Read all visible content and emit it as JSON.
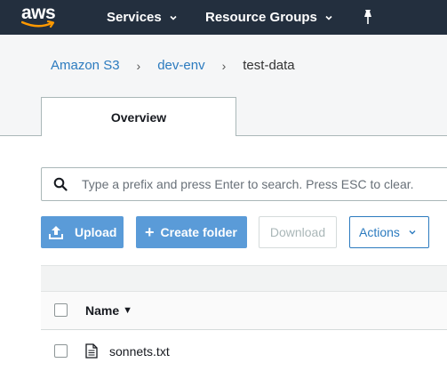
{
  "header": {
    "logo_text": "aws",
    "nav": {
      "services_label": "Services",
      "resource_groups_label": "Resource Groups"
    }
  },
  "breadcrumb": {
    "items": [
      {
        "label": "Amazon S3"
      },
      {
        "label": "dev-env"
      },
      {
        "label": "test-data"
      }
    ],
    "separator": "›"
  },
  "tabs": [
    {
      "label": "Overview",
      "active": true
    }
  ],
  "search": {
    "value": "",
    "placeholder": "Type a prefix and press Enter to search. Press ESC to clear."
  },
  "toolbar": {
    "upload_label": "Upload",
    "create_folder_label": "Create folder",
    "download_label": "Download",
    "actions_label": "Actions"
  },
  "table": {
    "columns": [
      {
        "label": "Name",
        "sort": "descending"
      }
    ],
    "rows": [
      {
        "name": "sonnets.txt",
        "type": "file-icon"
      }
    ]
  },
  "colors": {
    "topbar": "#232f3e",
    "link": "#2c7bbf",
    "primary_button": "#5a9bd8",
    "aws_smile": "#ff9900"
  }
}
